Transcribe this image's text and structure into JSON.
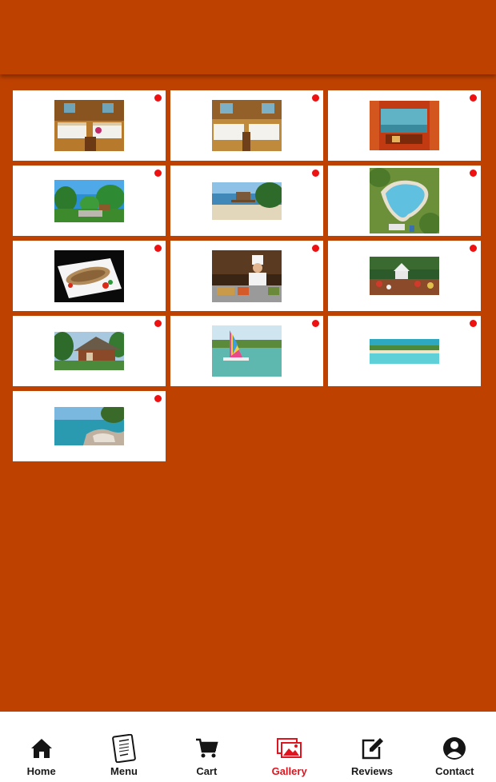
{
  "gallery": {
    "items": [
      {
        "name": "Room interior with twin beds",
        "image": "room-twin-beds-1"
      },
      {
        "name": "Room interior with twin beds",
        "image": "room-twin-beds-2"
      },
      {
        "name": "Room with sea view",
        "image": "room-sea-view"
      },
      {
        "name": "Garden with palm trees",
        "image": "garden-palms"
      },
      {
        "name": "Beach with boardwalk",
        "image": "beach-boardwalk"
      },
      {
        "name": "Swimming pool aerial",
        "image": "pool-aerial"
      },
      {
        "name": "Grilled fish dish",
        "image": "fish-dish"
      },
      {
        "name": "Chef at buffet",
        "image": "chef-buffet"
      },
      {
        "name": "Outdoor dining area",
        "image": "outdoor-dining"
      },
      {
        "name": "Thatched bungalow",
        "image": "bungalow"
      },
      {
        "name": "Catamaran on beach",
        "image": "catamaran"
      },
      {
        "name": "Aerial beach view",
        "image": "beach-aerial"
      },
      {
        "name": "Rocky coastline",
        "image": "rocky-coast"
      }
    ],
    "badge_color": "#ee1111"
  },
  "nav": {
    "items": [
      {
        "label": "Home",
        "icon": "home-icon"
      },
      {
        "label": "Menu",
        "icon": "menu-book-icon"
      },
      {
        "label": "Cart",
        "icon": "cart-icon"
      },
      {
        "label": "Gallery",
        "icon": "gallery-icon",
        "active": true
      },
      {
        "label": "Reviews",
        "icon": "edit-icon"
      },
      {
        "label": "Contact",
        "icon": "contact-icon"
      }
    ],
    "active_color": "#e0141e"
  },
  "colors": {
    "background": "#bf4100",
    "card": "#ffffff"
  }
}
